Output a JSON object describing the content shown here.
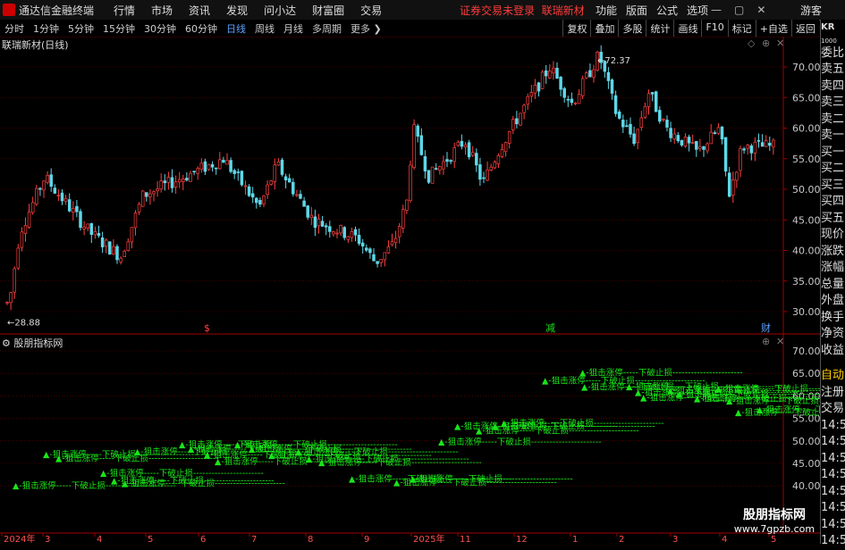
{
  "app": {
    "title": "通达信金融终端"
  },
  "menu": [
    "行情",
    "市场",
    "资讯",
    "发现",
    "问小达",
    "财富圈",
    "交易"
  ],
  "notice": "证券交易未登录",
  "notice_stock": "联瑞新材",
  "right_menu": [
    "功能",
    "版面",
    "公式",
    "选项"
  ],
  "guest": "游客",
  "periods": {
    "items": [
      "分时",
      "1分钟",
      "5分钟",
      "15分钟",
      "30分钟",
      "60分钟",
      "日线",
      "周线",
      "月线",
      "多周期",
      "更多"
    ],
    "active": "日线"
  },
  "right_tools": [
    "复权",
    "叠加",
    "多股",
    "统计",
    "画线",
    "F10",
    "标记",
    "+自选",
    "返回"
  ],
  "chart": {
    "title": "联瑞新材(日线)",
    "high_label": "72.37",
    "low_label": "28.88",
    "y_ticks": [
      "70.00",
      "65.00",
      "60.00",
      "55.00",
      "50.00",
      "45.00",
      "40.00",
      "35.00",
      "30.00"
    ],
    "markers": [
      "$",
      "减",
      "财"
    ]
  },
  "sub_chart": {
    "title": "股朋指标网",
    "y_ticks": [
      "70.00",
      "65.00",
      "60.00",
      "55.00",
      "50.00",
      "45.00",
      "40.00"
    ],
    "signal_text": "▲-狙击涨停-----下破止损-----------------------"
  },
  "x_axis": [
    "2024年",
    "3",
    "4",
    "5",
    "6",
    "7",
    "8",
    "9",
    "2025年",
    "11",
    "12",
    "1",
    "2",
    "3",
    "4",
    "5"
  ],
  "right_panel": {
    "code": "KR",
    "code2": "1000",
    "items": [
      "委比",
      "卖五",
      "卖四",
      "卖三",
      "卖二",
      "卖一",
      "买一",
      "买二",
      "买三",
      "买四",
      "买五",
      "现价",
      "涨跌",
      "涨幅",
      "总量",
      "外盘",
      "换手",
      "净资",
      "收益"
    ],
    "sub_items": [
      "自动",
      "注册",
      "交易",
      "14:5",
      "14:5",
      "14:5",
      "14:5",
      "14:5",
      "14:5",
      "14:5",
      "14:5"
    ]
  },
  "watermark": {
    "line1": "股朋指标网",
    "line2": "www.7gpzb.com"
  },
  "colors": {
    "up": "#ff4040",
    "down": "#5fd7e8",
    "grid": "#7a0000",
    "signal": "#19e619",
    "axis_text": "#c8c8c8"
  }
}
